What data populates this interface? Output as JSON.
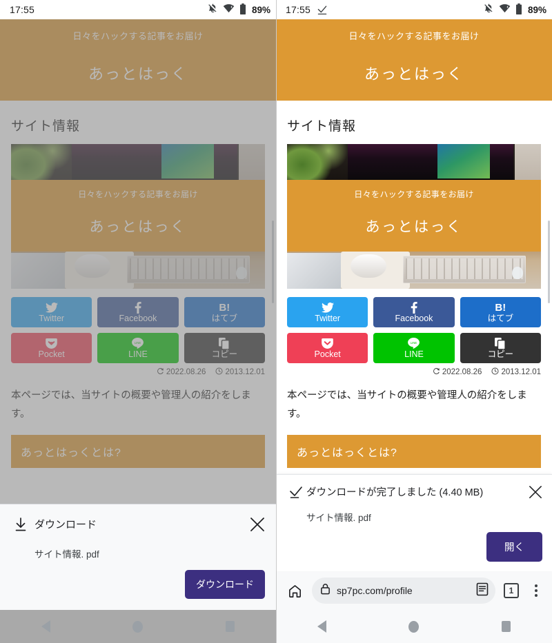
{
  "panels": [
    {
      "id": "before",
      "status": {
        "time": "17:55",
        "battery": "89%",
        "download_icon": false,
        "icons": [
          "notifications-off-icon",
          "wifi-icon",
          "battery-icon"
        ]
      },
      "dimmed": true,
      "site": {
        "tagline": "日々をハックする記事をお届け",
        "title": "あっとはっく"
      },
      "page": {
        "title": "サイト情報",
        "hero": {
          "tagline": "日々をハックする記事をお届け",
          "title": "あっとはっく"
        },
        "share": [
          {
            "name": "twitter",
            "label": "Twitter",
            "icon": "twitter-bird-icon",
            "color": "#2aa3ef"
          },
          {
            "name": "facebook",
            "label": "Facebook",
            "icon": "facebook-f-icon",
            "color": "#3b5998"
          },
          {
            "name": "hatena",
            "label": "はてブ",
            "icon": "hatena-b-icon",
            "color": "#1d6ec9"
          },
          {
            "name": "pocket",
            "label": "Pocket",
            "icon": "pocket-icon",
            "color": "#ef4056"
          },
          {
            "name": "line",
            "label": "LINE",
            "icon": "line-icon",
            "color": "#00c300"
          },
          {
            "name": "copy",
            "label": "コピー",
            "icon": "copy-icon",
            "color": "#333333"
          }
        ],
        "dates": [
          {
            "icon": "updated-icon",
            "value": "2022.08.26"
          },
          {
            "icon": "clock-icon",
            "value": "2013.12.01"
          }
        ],
        "paragraph": "本ページでは、当サイトの概要や管理人の紹介をします。",
        "heading": "あっとはっくとは?"
      },
      "dialog": {
        "kind": "download-prompt",
        "icon": "download-arrow-icon",
        "title": "ダウンロード",
        "filename": "サイト情報. pdf",
        "action_label": "ダウンロード",
        "close_icon": "close-icon",
        "accent": "#3c2f80"
      },
      "browser_bar_visible": false,
      "nav": {
        "back": "back-triangle-icon",
        "home": "home-circle-icon",
        "recents": "recents-square-icon"
      }
    },
    {
      "id": "after",
      "status": {
        "time": "17:55",
        "battery": "89%",
        "download_icon": true,
        "icons": [
          "notifications-off-icon",
          "wifi-icon",
          "battery-icon"
        ]
      },
      "dimmed": false,
      "site": {
        "tagline": "日々をハックする記事をお届け",
        "title": "あっとはっく"
      },
      "page": {
        "title": "サイト情報",
        "hero": {
          "tagline": "日々をハックする記事をお届け",
          "title": "あっとはっく"
        },
        "share": [
          {
            "name": "twitter",
            "label": "Twitter",
            "icon": "twitter-bird-icon",
            "color": "#2aa3ef"
          },
          {
            "name": "facebook",
            "label": "Facebook",
            "icon": "facebook-f-icon",
            "color": "#3b5998"
          },
          {
            "name": "hatena",
            "label": "はてブ",
            "icon": "hatena-b-icon",
            "color": "#1d6ec9"
          },
          {
            "name": "pocket",
            "label": "Pocket",
            "icon": "pocket-icon",
            "color": "#ef4056"
          },
          {
            "name": "line",
            "label": "LINE",
            "icon": "line-icon",
            "color": "#00c300"
          },
          {
            "name": "copy",
            "label": "コピー",
            "icon": "copy-icon",
            "color": "#333333"
          }
        ],
        "dates": [
          {
            "icon": "updated-icon",
            "value": "2022.08.26"
          },
          {
            "icon": "clock-icon",
            "value": "2013.12.01"
          }
        ],
        "paragraph": "本ページでは、当サイトの概要や管理人の紹介をします。",
        "heading": "あっとはっくとは?"
      },
      "dialog": {
        "kind": "download-complete",
        "icon": "download-complete-check-icon",
        "title": "ダウンロードが完了しました (4.40 MB)",
        "filename": "サイト情報. pdf",
        "action_label": "開く",
        "close_icon": "close-icon",
        "accent": "#3c2f80"
      },
      "browser_bar_visible": true,
      "browser_bar": {
        "home_icon": "home-icon",
        "lock_icon": "lock-icon",
        "url": "sp7pc.com/profile",
        "reader_icon": "reader-mode-icon",
        "tab_count": "1",
        "menu_icon": "overflow-menu-icon"
      },
      "nav": {
        "back": "back-triangle-icon",
        "home": "home-circle-icon",
        "recents": "recents-square-icon"
      }
    }
  ],
  "theme": {
    "brand_orange": "#dd9933",
    "accent_purple": "#3c2f80",
    "nav_grey": "#9aa0a6"
  }
}
